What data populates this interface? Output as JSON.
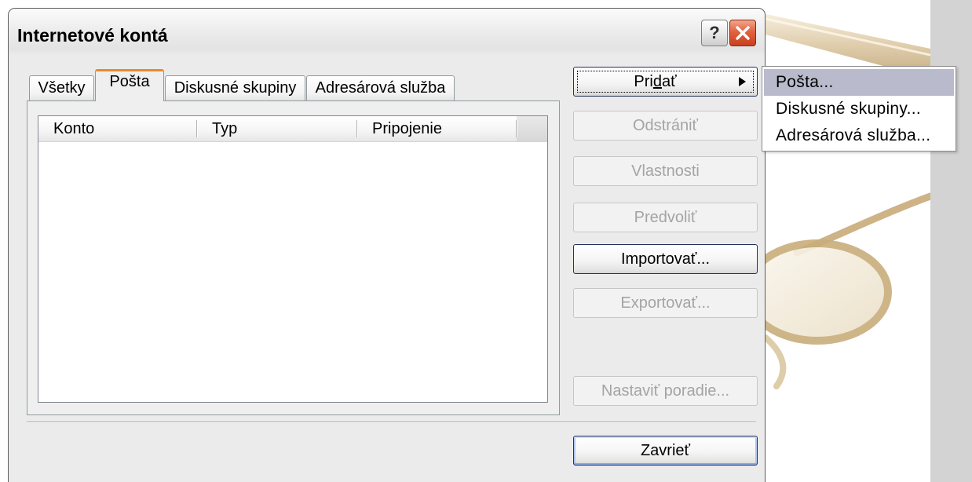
{
  "window": {
    "title": "Internetové kontá",
    "help_label": "?"
  },
  "tabs": [
    {
      "label": "Všetky",
      "selected": false
    },
    {
      "label": "Pošta",
      "selected": true
    },
    {
      "label": "Diskusné skupiny",
      "selected": false
    },
    {
      "label": "Adresárová služba",
      "selected": false
    }
  ],
  "accounts_list": {
    "columns": [
      "Konto",
      "Typ",
      "Pripojenie"
    ],
    "rows": []
  },
  "buttons": {
    "add": {
      "label": "Pridať",
      "accelerator_index": 3,
      "enabled": true,
      "focused": true,
      "has_submenu": true
    },
    "remove": {
      "label": "Odstrániť",
      "enabled": false
    },
    "properties": {
      "label": "Vlastnosti",
      "enabled": false
    },
    "set_default": {
      "label": "Predvoliť",
      "enabled": false
    },
    "import": {
      "label": "Importovať...",
      "enabled": true
    },
    "export": {
      "label": "Exportovať...",
      "enabled": false
    },
    "set_order": {
      "label": "Nastaviť poradie...",
      "enabled": false
    },
    "close": {
      "label": "Zavrieť",
      "enabled": true,
      "default": true
    }
  },
  "add_menu": {
    "items": [
      {
        "label": "Pošta...",
        "highlighted": true
      },
      {
        "label": "Diskusné skupiny...",
        "highlighted": false
      },
      {
        "label": "Adresárová služba...",
        "highlighted": false
      }
    ]
  },
  "icons": {
    "help": "help-icon",
    "close": "close-icon",
    "submenu_arrow": "submenu-arrow-icon"
  },
  "colors": {
    "selected_tab_accent": "#E68B2C",
    "menu_highlight": "#B9BACB",
    "close_button": "#E2623E",
    "disabled_text": "#A4A4A4",
    "dialog_background": "#EBEBEB"
  }
}
